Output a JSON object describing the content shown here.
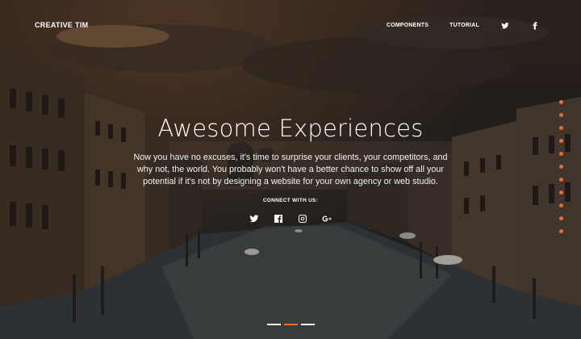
{
  "brand": "CREATIVE TIM",
  "nav": {
    "components": "COMPONENTS",
    "tutorial": "TUTORIAL",
    "icons": [
      "twitter-icon",
      "facebook-icon"
    ]
  },
  "hero": {
    "title": "Awesome Experiences",
    "description": "Now you have no excuses, it's time to surprise your clients, your competitors, and why not, the world. You probably won't have a better chance to show off all your potential if it's not by designing a website for your own agency or web studio.",
    "connect_label": "CONNECT WITH US:",
    "social_icons": [
      "twitter-icon",
      "facebook-icon",
      "instagram-icon",
      "google-plus-icon"
    ]
  },
  "side_dots_count": 11,
  "carousel": {
    "slides": 3,
    "active_index": 1
  },
  "colors": {
    "accent": "#e46f2c",
    "text": "#ffffff"
  }
}
